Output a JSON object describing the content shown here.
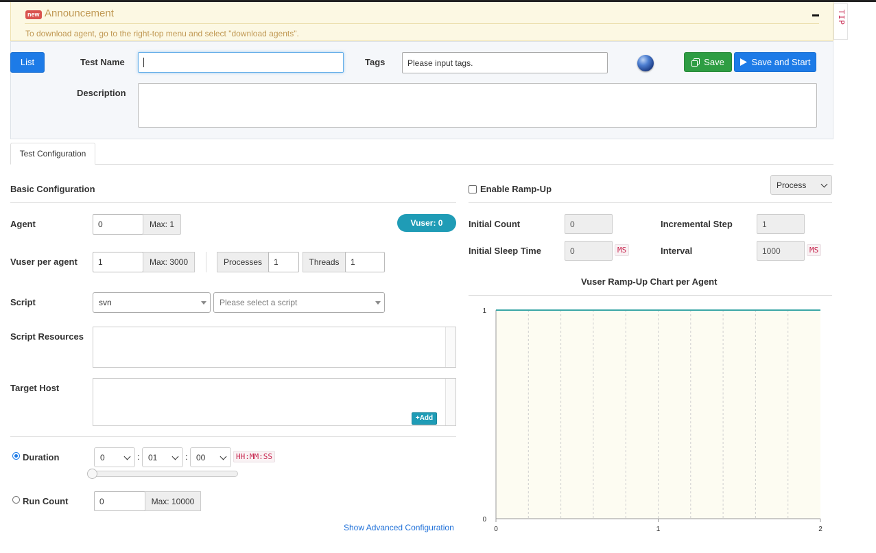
{
  "announcement": {
    "badge": "new",
    "title": "Announcement",
    "message": "To download agent, go to the right-top menu and select \"download agents\".",
    "tip_label": "TIP"
  },
  "header": {
    "list_button": "List",
    "test_name_label": "Test Name",
    "test_name_value": "",
    "tags_label": "Tags",
    "tags_placeholder": "Please input tags.",
    "save_button": "Save",
    "save_start_button": "Save and Start",
    "description_label": "Description",
    "description_value": ""
  },
  "tabs": [
    {
      "label": "Test Configuration",
      "active": true
    }
  ],
  "basic": {
    "section_title": "Basic Configuration",
    "agent_label": "Agent",
    "agent_value": "0",
    "agent_max": "Max: 1",
    "vuser_badge": "Vuser: 0",
    "vuser_per_agent_label": "Vuser per agent",
    "vuser_per_agent_value": "1",
    "vuser_per_agent_max": "Max: 3000",
    "processes_label": "Processes",
    "processes_value": "1",
    "threads_label": "Threads",
    "threads_value": "1",
    "script_label": "Script",
    "script_type_value": "svn",
    "script_placeholder": "Please select a script",
    "script_resources_label": "Script Resources",
    "target_host_label": "Target Host",
    "add_button": "Add",
    "duration_label": "Duration",
    "duration_selected": true,
    "duration_hours": "0",
    "duration_minutes": "01",
    "duration_seconds": "00",
    "duration_format": "HH:MM:SS",
    "duration_colon": ":",
    "duration_slider_fraction": 0,
    "run_count_label": "Run Count",
    "run_count_value": "0",
    "run_count_max": "Max: 10000",
    "advanced_link": "Show Advanced Configuration"
  },
  "rampup": {
    "enable_label": "Enable Ramp-Up",
    "enabled": false,
    "mode_select": "Process",
    "initial_count_label": "Initial Count",
    "initial_count_value": "0",
    "incremental_step_label": "Incremental Step",
    "incremental_step_value": "1",
    "initial_sleep_label": "Initial Sleep Time",
    "initial_sleep_value": "0",
    "initial_sleep_unit": "MS",
    "interval_label": "Interval",
    "interval_value": "1000",
    "interval_unit": "MS"
  },
  "chart_data": {
    "type": "line",
    "title": "Vuser Ramp-Up Chart per Agent",
    "xlabel": "",
    "ylabel": "",
    "xlim": [
      0,
      2
    ],
    "ylim": [
      0,
      1
    ],
    "x_ticks": [
      "0",
      "1",
      "2"
    ],
    "y_ticks": [
      "0",
      "1"
    ],
    "x_minor_gridlines": [
      0.2,
      0.4,
      0.6,
      0.8,
      1.0,
      1.2,
      1.4,
      1.6,
      1.8
    ],
    "series": [
      {
        "x": [
          0,
          2
        ],
        "y": [
          1,
          1
        ],
        "color": "#3aa6a6"
      }
    ],
    "background": "#fdfcf2",
    "grid": true
  }
}
